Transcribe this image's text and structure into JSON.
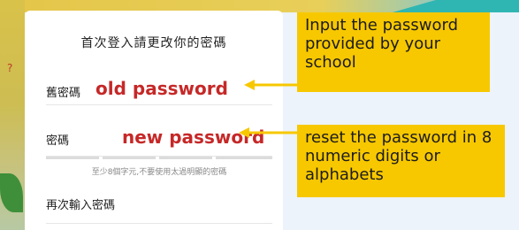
{
  "card": {
    "title": "首次登入請更改你的密碼",
    "fields": {
      "old_password": {
        "label": "舊密碼",
        "value": "old password"
      },
      "new_password": {
        "label": "密碼",
        "value": "new password"
      },
      "confirm_password": {
        "label": "再次輸入密碼",
        "value": ""
      }
    },
    "hint": "至少8個字元,不要使用太過明顯的密碼"
  },
  "callouts": [
    {
      "text": "Input the password provided by your school"
    },
    {
      "text": "reset the password in 8 numeric digits or alphabets"
    }
  ],
  "colors": {
    "callout_bg": "#f7c800",
    "value_text": "#c62828",
    "background": "#ecf3fb",
    "accent_teal": "#2fb6b2"
  }
}
